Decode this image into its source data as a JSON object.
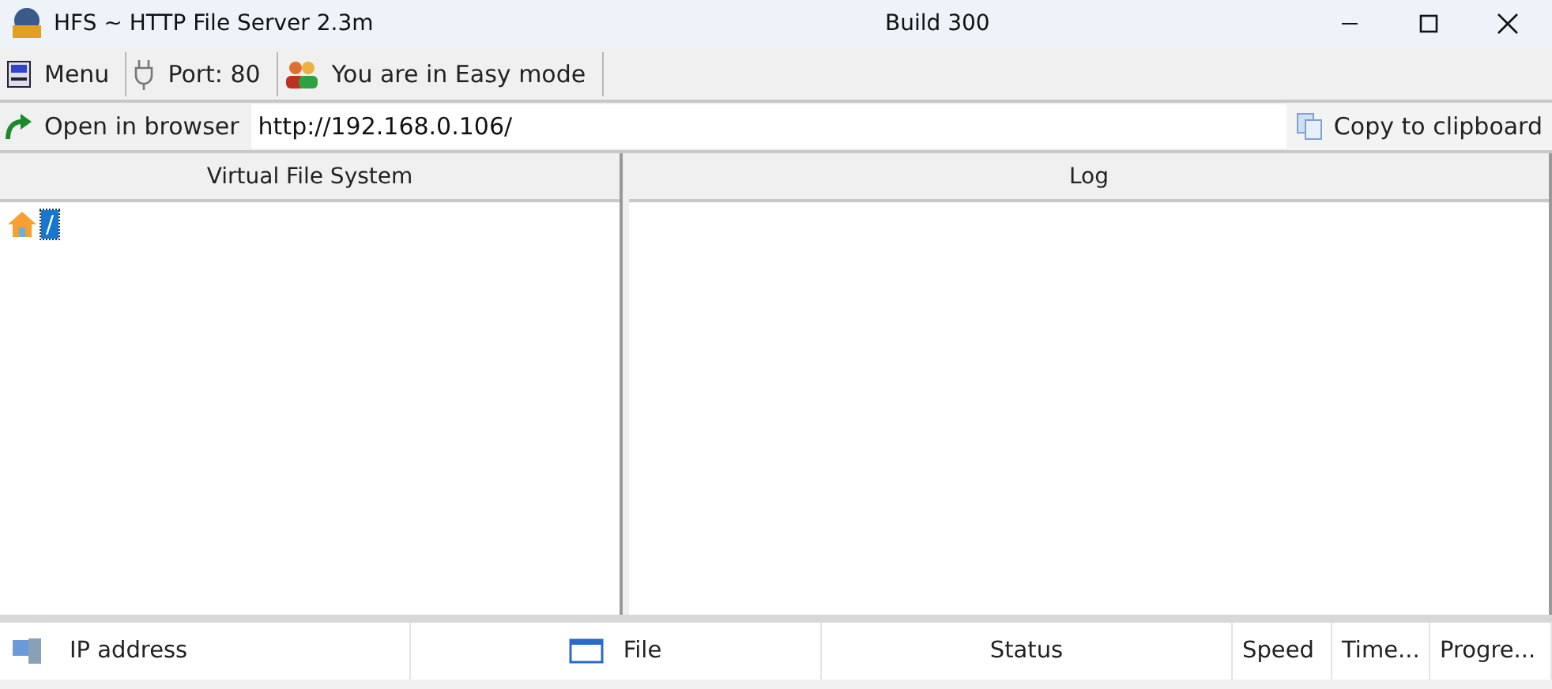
{
  "window": {
    "title": "HFS ~ HTTP File Server 2.3m",
    "build": "Build 300"
  },
  "toolbar": [
    {
      "kind": "menu",
      "label": "Menu"
    },
    {
      "kind": "port",
      "label": "Port: 80"
    },
    {
      "kind": "mode",
      "label": "You are in Easy mode"
    }
  ],
  "address_bar": {
    "open_label": "Open in browser",
    "value": "http://192.168.0.106/",
    "copy_label": "Copy to clipboard"
  },
  "vfs": {
    "title": "Virtual File System",
    "root": {
      "label": "/",
      "selected": true
    }
  },
  "log": {
    "title": "Log"
  },
  "connections": {
    "columns": [
      {
        "kind": "ip",
        "label": "IP address"
      },
      {
        "kind": "file",
        "label": "File"
      },
      {
        "kind": "plain",
        "label": "Status"
      },
      {
        "kind": "plain",
        "label": "Speed"
      },
      {
        "kind": "plain",
        "label": "Time..."
      },
      {
        "kind": "plain",
        "label": "Progre..."
      }
    ]
  }
}
